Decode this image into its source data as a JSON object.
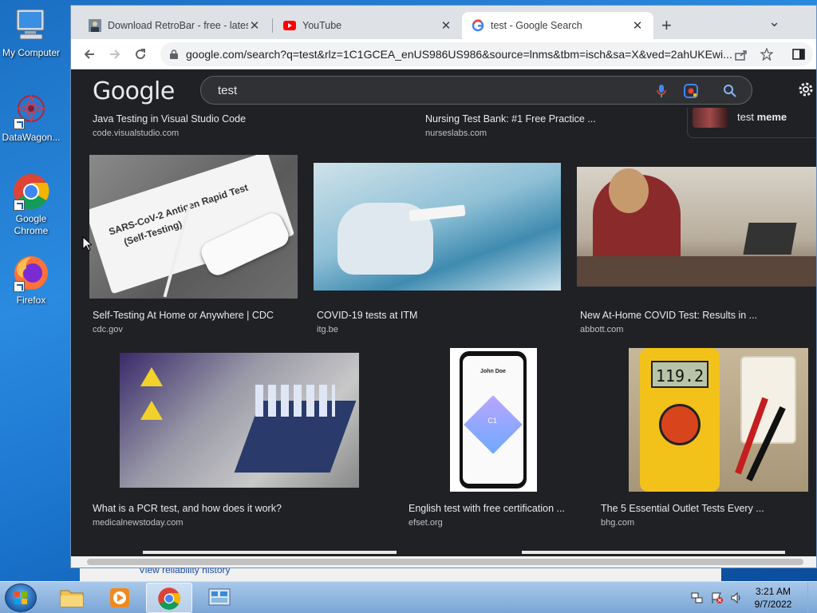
{
  "desktop": {
    "icons": [
      {
        "label": "My Computer"
      },
      {
        "label": "DataWagon..."
      },
      {
        "label": "Google Chrome"
      },
      {
        "label": "Firefox"
      }
    ]
  },
  "background_window": {
    "link_text": "View reliability history"
  },
  "browser": {
    "tabs": [
      {
        "title": "Download RetroBar - free - latest",
        "close": "✕"
      },
      {
        "title": "YouTube",
        "close": "✕"
      },
      {
        "title": "test - Google Search",
        "close": "✕"
      }
    ],
    "new_tab": "+",
    "tab_menu": "⌄",
    "url": "google.com/search?q=test&rlz=1C1GCEA_enUS986US986&source=lnms&tbm=isch&sa=X&ved=2ahUKEwi..."
  },
  "google": {
    "logo": "Google",
    "query": "test",
    "related_chip": {
      "prefix": "test ",
      "bold": "meme"
    },
    "top_results": [
      {
        "title": "Java Testing in Visual Studio Code",
        "source": "code.visualstudio.com"
      },
      {
        "title": "Nursing Test Bank: #1 Free Practice ...",
        "source": "nurseslabs.com"
      }
    ],
    "row1": [
      {
        "title": "Self-Testing At Home or Anywhere | CDC",
        "source": "cdc.gov",
        "image_text_1": "SARS-CoV-2 Antigen Rapid Test",
        "image_text_2": "(Self-Testing)"
      },
      {
        "title": "COVID-19 tests at ITM",
        "source": "itg.be"
      },
      {
        "title": "New At-Home COVID Test: Results in ...",
        "source": "abbott.com"
      }
    ],
    "row2": [
      {
        "title": "What is a PCR test, and how does it work?",
        "source": "medicalnewstoday.com"
      },
      {
        "title": "English test with free certification ...",
        "source": "efset.org",
        "image_text_1": "John Doe",
        "image_text_2": "C1"
      },
      {
        "title": "The 5 Essential Outlet Tests Every ...",
        "source": "bhg.com",
        "image_text_1": "119.2"
      }
    ]
  },
  "taskbar": {
    "time": "3:21 AM",
    "date": "9/7/2022"
  }
}
